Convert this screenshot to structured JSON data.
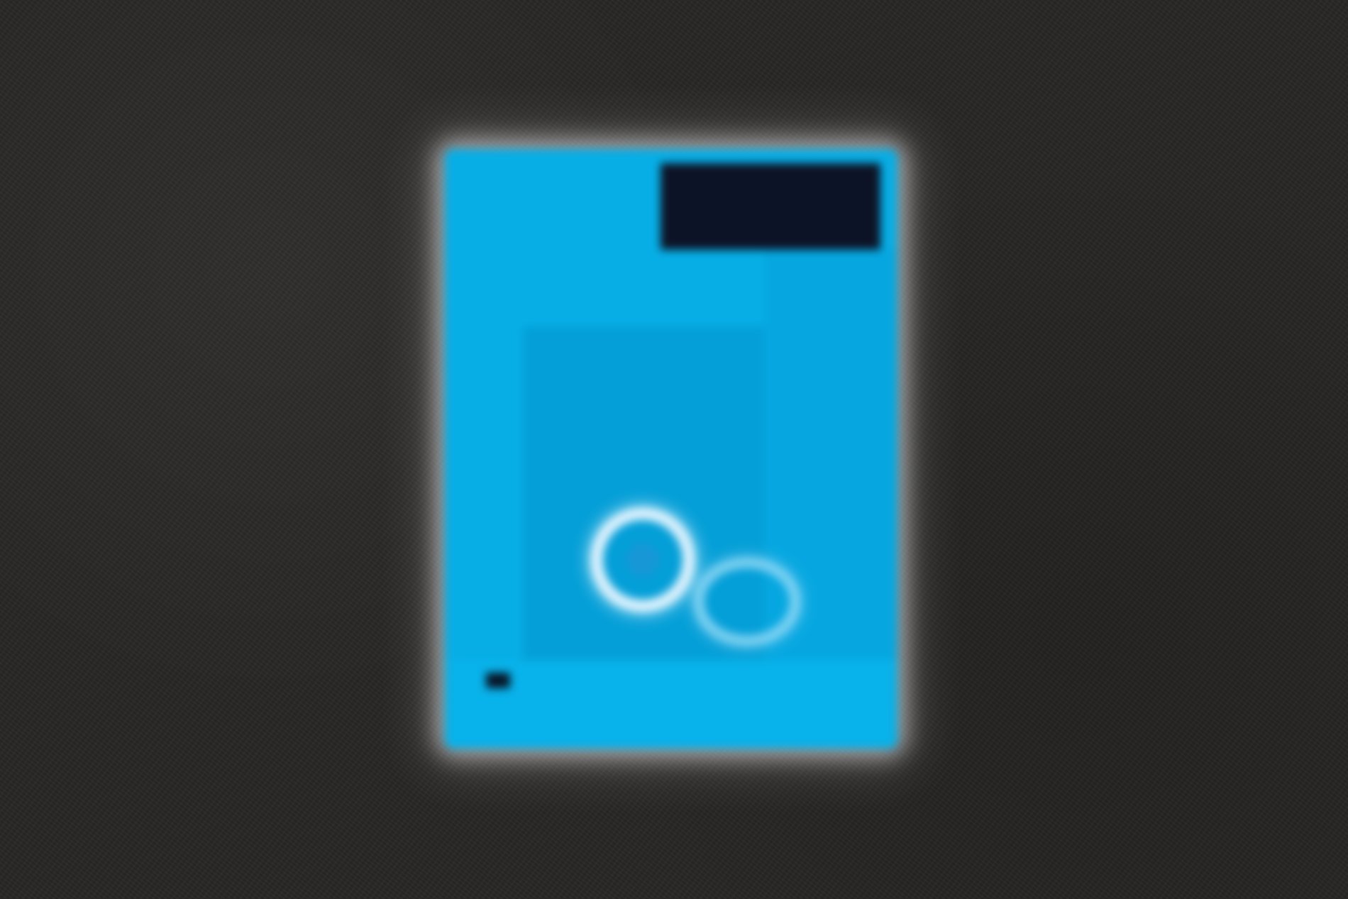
{
  "screen": {
    "background_color": "#282726"
  },
  "booklet": {
    "corner_label": "",
    "small_text": "",
    "headline": "",
    "logo_text": "",
    "colors": {
      "cover_blue": "#07aee6",
      "panel_blue": "#049fd8",
      "dark_box": "#0d1326",
      "ring_light": "#e6f5ff"
    },
    "icon_names": [
      "ring-icon",
      "logo-icon"
    ]
  }
}
